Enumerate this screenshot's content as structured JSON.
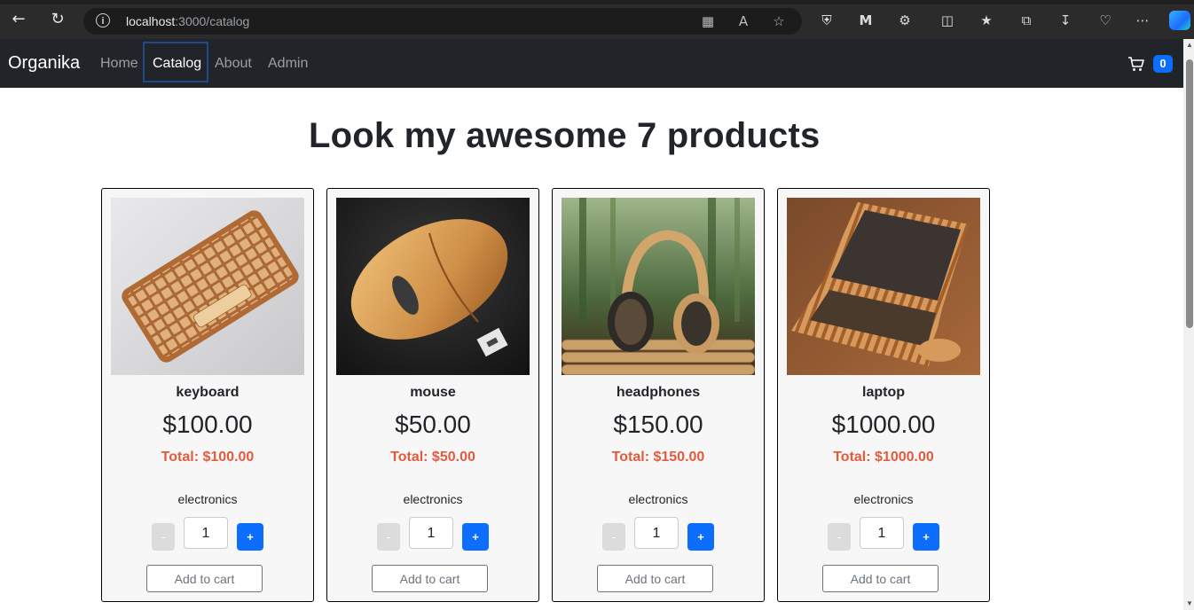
{
  "browser": {
    "url_host": "localhost",
    "url_path": ":3000/catalog"
  },
  "navbar": {
    "brand": "Organika",
    "links": [
      "Home",
      "Catalog",
      "About",
      "Admin"
    ],
    "active_link": "Catalog",
    "cart_count": "0"
  },
  "page": {
    "heading": "Look my awesome 7 products"
  },
  "products": [
    {
      "name": "keyboard",
      "price": "$100.00",
      "total": "Total: $100.00",
      "category": "electronics",
      "quantity": "1",
      "minus": "-",
      "plus": "+",
      "add_to_cart": "Add to cart"
    },
    {
      "name": "mouse",
      "price": "$50.00",
      "total": "Total: $50.00",
      "category": "electronics",
      "quantity": "1",
      "minus": "-",
      "plus": "+",
      "add_to_cart": "Add to cart"
    },
    {
      "name": "headphones",
      "price": "$150.00",
      "total": "Total: $150.00",
      "category": "electronics",
      "quantity": "1",
      "minus": "-",
      "plus": "+",
      "add_to_cart": "Add to cart"
    },
    {
      "name": "laptop",
      "price": "$1000.00",
      "total": "Total: $1000.00",
      "category": "electronics",
      "quantity": "1",
      "minus": "-",
      "plus": "+",
      "add_to_cart": "Add to cart"
    }
  ],
  "colors": {
    "navbar_bg": "#212529",
    "accent": "#0d6efd",
    "total_text": "#e35b3f"
  }
}
